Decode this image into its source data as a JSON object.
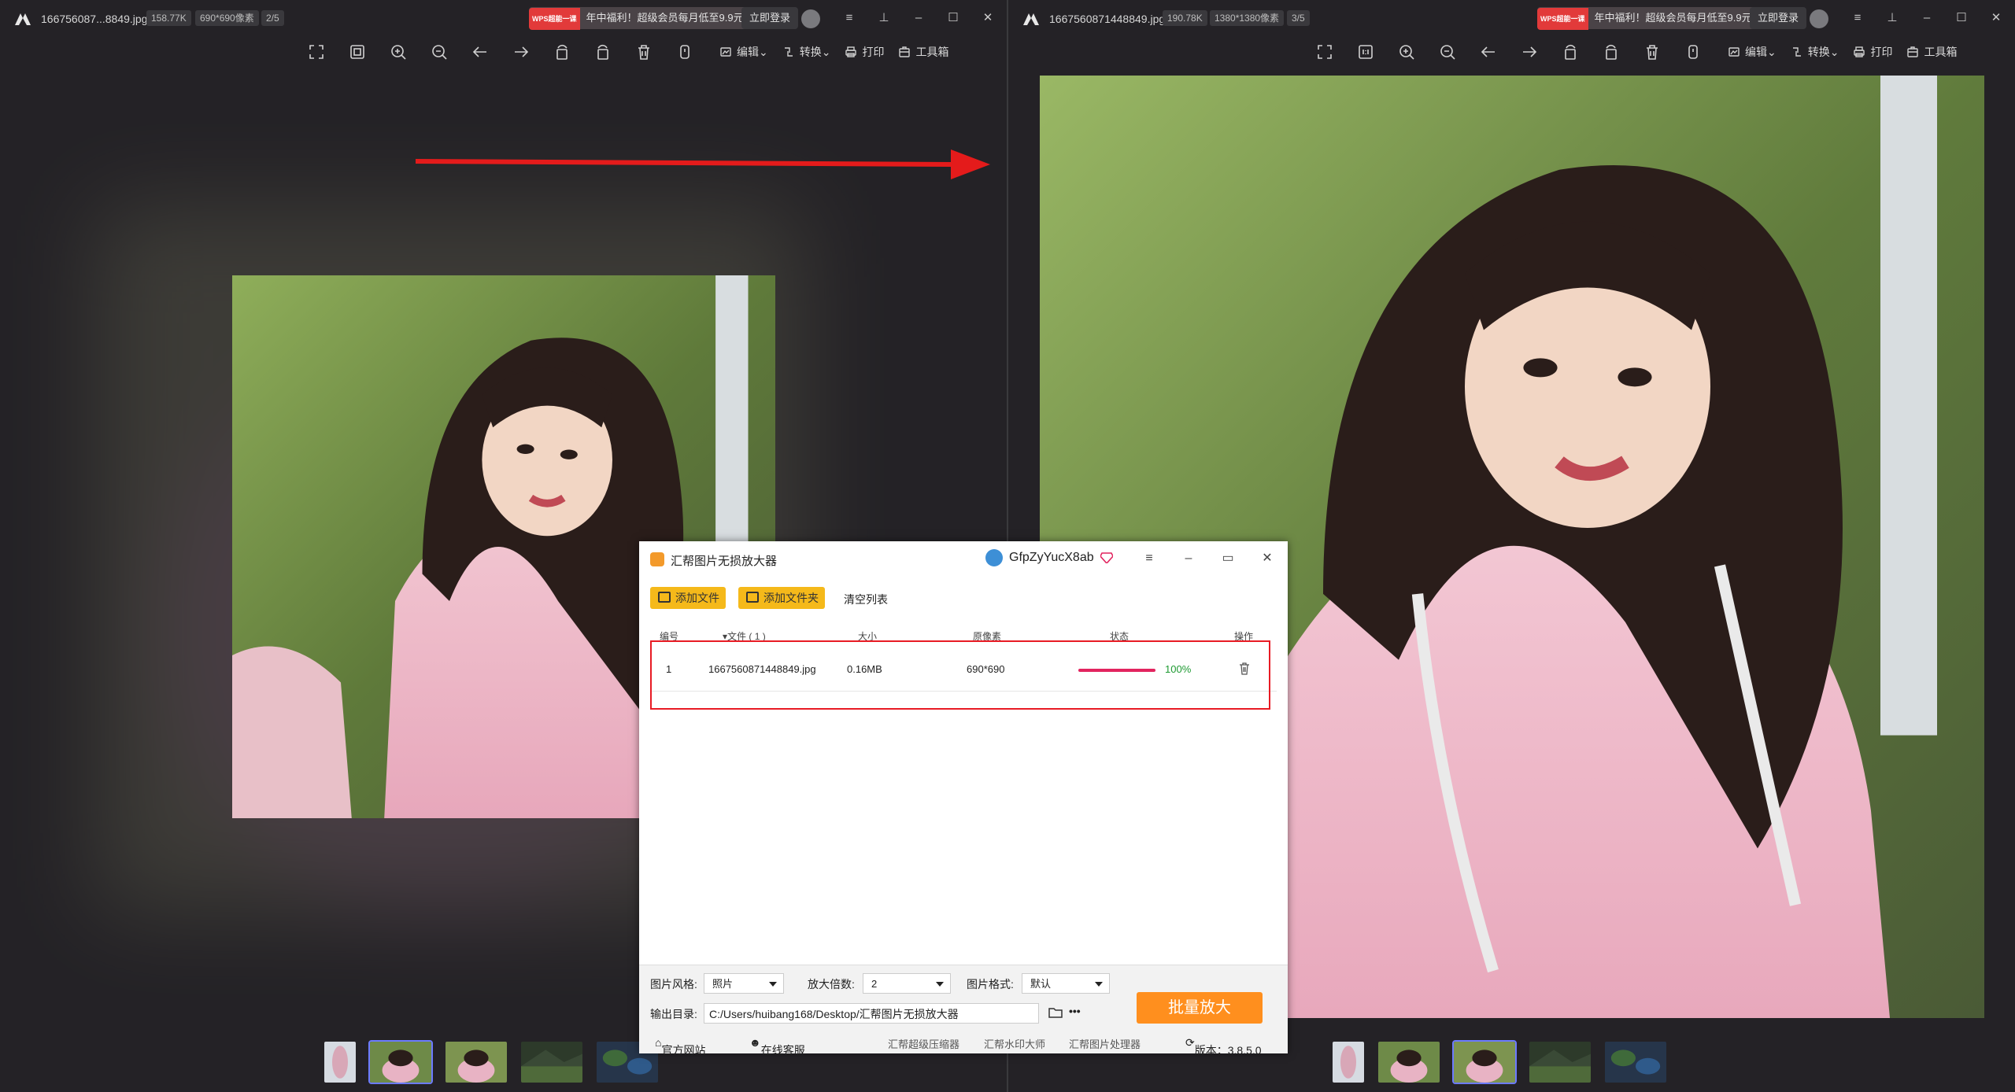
{
  "left": {
    "filename": "166756087...8849.jpg",
    "size": "158.77K",
    "dims": "690*690像素",
    "index": "2/5"
  },
  "right": {
    "filename": "1667560871448849.jpg",
    "size": "190.78K",
    "dims": "1380*1380像素",
    "index": "3/5"
  },
  "promo": {
    "badge": "WPS超能一课",
    "text": "年中福利！超级会员每月低至9.9元"
  },
  "login_label": "立即登录",
  "toolbar": {
    "edit": "编辑",
    "convert": "转换",
    "print": "打印",
    "toolbox": "工具箱"
  },
  "app": {
    "title": "汇帮图片无损放大器",
    "username": "GfpZyYucX8ab",
    "add_file": "添加文件",
    "add_folder": "添加文件夹",
    "clear_list": "清空列表",
    "columns": {
      "no": "编号",
      "file": "▾文件 ( 1 )",
      "size": "大小",
      "pixels": "原像素",
      "status": "状态",
      "action": "操作"
    },
    "rows": [
      {
        "no": "1",
        "file": "1667560871448849.jpg",
        "size": "0.16MB",
        "pixels": "690*690",
        "progress": "100%"
      }
    ],
    "style_label": "图片风格:",
    "style_value": "照片",
    "scale_label": "放大倍数:",
    "scale_value": "2",
    "format_label": "图片格式:",
    "format_value": "默认",
    "output_label": "输出目录:",
    "output_path": "C:/Users/huibang168/Desktop/汇帮图片无损放大器",
    "more": "•••",
    "batch_button": "批量放大",
    "footer": {
      "website": "官方网站",
      "service": "在线客服",
      "link1": "汇帮超级压缩器",
      "link2": "汇帮水印大师",
      "link3": "汇帮图片处理器",
      "version": "版本：3.8.5.0"
    }
  }
}
